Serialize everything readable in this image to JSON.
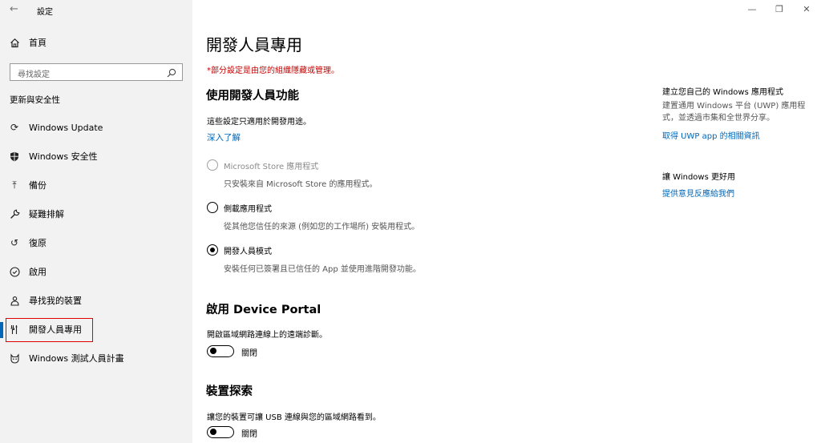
{
  "app": {
    "title": "設定",
    "back_glyph": "←",
    "window_controls": {
      "minimize": "—",
      "restore": "❐",
      "close": "✕"
    }
  },
  "sidebar": {
    "home": {
      "label": "首頁",
      "icon": "home-icon"
    },
    "search": {
      "placeholder": "尋找設定",
      "icon": "search-icon"
    },
    "section_title": "更新與安全性",
    "items": [
      {
        "label": "Windows Update",
        "icon": "sync-icon",
        "glyph": "⟳"
      },
      {
        "label": "Windows 安全性",
        "icon": "shield-icon",
        "glyph": "⛊"
      },
      {
        "label": "備份",
        "icon": "backup-arrow-icon",
        "glyph": "⤒"
      },
      {
        "label": "疑難排解",
        "icon": "wrench-icon",
        "glyph": "🔧"
      },
      {
        "label": "復原",
        "icon": "recovery-icon",
        "glyph": "↺"
      },
      {
        "label": "啟用",
        "icon": "check-circle-icon",
        "glyph": "✓"
      },
      {
        "label": "尋找我的裝置",
        "icon": "person-locate-icon",
        "glyph": "♙"
      },
      {
        "label": "開發人員專用",
        "icon": "developer-tools-icon",
        "glyph": "⫶",
        "selected": true
      },
      {
        "label": "Windows 測試人員計畫",
        "icon": "insider-cat-icon",
        "glyph": "☺"
      }
    ],
    "accent_color": "#0067b8",
    "highlight_color": "#e00000"
  },
  "main": {
    "title": "開發人員專用",
    "managed_note": "*部分設定是由您的組織隱藏或管理。",
    "dev_features": {
      "heading": "使用開發人員功能",
      "intro": "這些設定只適用於開發用途。",
      "learn_more": "深入了解",
      "options": [
        {
          "label": "Microsoft Store 應用程式",
          "desc": "只安裝來自 Microsoft Store 的應用程式。",
          "state": "disabled"
        },
        {
          "label": "側載應用程式",
          "desc": "從其他您信任的來源 (例如您的工作場所) 安裝用程式。",
          "state": "unchecked"
        },
        {
          "label": "開發人員模式",
          "desc": "安裝任何已簽署且已信任的 App 並使用進階開發功能。",
          "state": "checked"
        }
      ]
    },
    "device_portal": {
      "heading": "啟用 Device Portal",
      "desc": "開啟區域網路連線上的遠端診斷。",
      "toggle_label": "關閉",
      "toggle_on": false
    },
    "device_discovery": {
      "heading": "裝置探索",
      "desc": "讓您的裝置可讓 USB 連線與您的區域網路看到。",
      "toggle_label": "關閉",
      "toggle_on": false
    }
  },
  "related": {
    "build_app": {
      "heading": "建立您自己的 Windows 應用程式",
      "body": "建置通用 Windows 平台 (UWP) 應用程式，並透過市集和全世界分享。",
      "link": "取得 UWP app 的相關資訊"
    },
    "feedback": {
      "heading": "讓 Windows 更好用",
      "link": "提供意見反應給我們"
    }
  }
}
